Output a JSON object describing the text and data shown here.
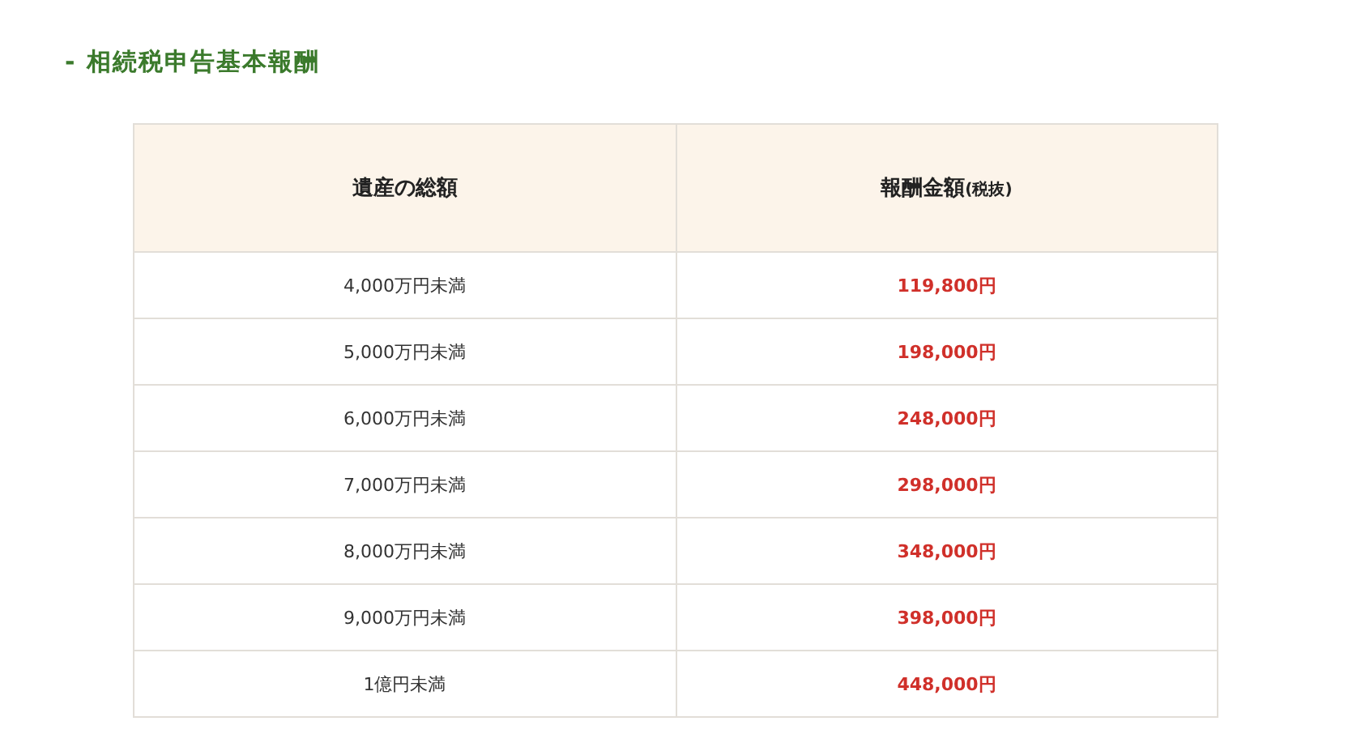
{
  "title": "- 相続税申告基本報酬",
  "table": {
    "columns": [
      {
        "label": "遺産の総額"
      },
      {
        "label": "報酬金額",
        "note": "(税抜)"
      }
    ],
    "rows": [
      {
        "estate": "4,000万円未満",
        "fee": "119,800円"
      },
      {
        "estate": "5,000万円未満",
        "fee": "198,000円"
      },
      {
        "estate": "6,000万円未満",
        "fee": "248,000円"
      },
      {
        "estate": "7,000万円未満",
        "fee": "298,000円"
      },
      {
        "estate": "8,000万円未満",
        "fee": "348,000円"
      },
      {
        "estate": "9,000万円未満",
        "fee": "398,000円"
      },
      {
        "estate": "1億円未満",
        "fee": "448,000円"
      }
    ]
  }
}
